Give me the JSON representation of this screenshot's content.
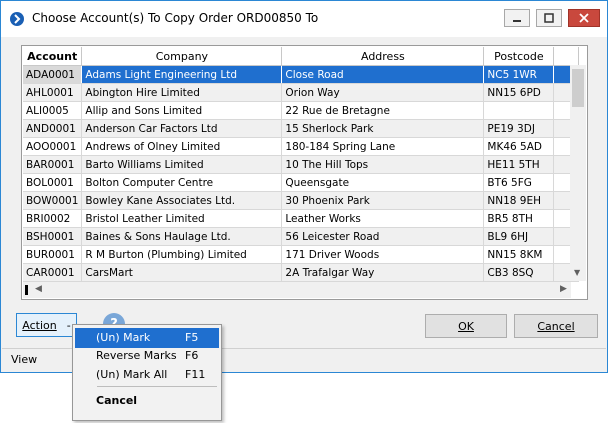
{
  "window": {
    "title": "Choose Account(s) To Copy Order ORD00850 To",
    "minimize_glyph": "—",
    "maximize_glyph": "□",
    "close_glyph": "✕"
  },
  "grid": {
    "columns": [
      "Account",
      "Company",
      "Address",
      "Postcode"
    ],
    "rows": [
      {
        "account": "ADA0001",
        "company": "Adams Light Engineering Ltd",
        "address": "Close Road",
        "postcode": "NC5 1WR"
      },
      {
        "account": "AHL0001",
        "company": "Abington Hire Limited",
        "address": "Orion Way",
        "postcode": "NN15 6PD"
      },
      {
        "account": "ALI0005",
        "company": "Allip and Sons Limited",
        "address": "22 Rue de Bretagne",
        "postcode": ""
      },
      {
        "account": "AND0001",
        "company": "Anderson Car Factors Ltd",
        "address": "15 Sherlock Park",
        "postcode": "PE19 3DJ"
      },
      {
        "account": "AOO0001",
        "company": "Andrews of Olney Limited",
        "address": "180-184 Spring Lane",
        "postcode": "MK46 5AD"
      },
      {
        "account": "BAR0001",
        "company": "Barto Williams Limited",
        "address": "10 The Hill Tops",
        "postcode": "HE11 5TH"
      },
      {
        "account": "BOL0001",
        "company": "Bolton Computer Centre",
        "address": "Queensgate",
        "postcode": "BT6 5FG"
      },
      {
        "account": "BOW0001",
        "company": "Bowley Kane Associates Ltd.",
        "address": "30 Phoenix Park",
        "postcode": "NN18 9EH"
      },
      {
        "account": "BRI0002",
        "company": "Bristol Leather Limited",
        "address": "Leather Works",
        "postcode": "BR5 8TH"
      },
      {
        "account": "BSH0001",
        "company": "Baines & Sons Haulage Ltd.",
        "address": "56 Leicester Road",
        "postcode": "BL9 6HJ"
      },
      {
        "account": "BUR0001",
        "company": "R M Burton (Plumbing) Limited",
        "address": "171 Driver Woods",
        "postcode": "NN15 8KM"
      },
      {
        "account": "CAR0001",
        "company": "CarsMart",
        "address": "2A Trafalgar Way",
        "postcode": "CB3 8SQ"
      }
    ]
  },
  "buttons": {
    "action_label": "Action",
    "action_caret": "-",
    "ok_label": "OK",
    "cancel_label": "Cancel",
    "help_glyph": "?"
  },
  "status": {
    "view_label": "View"
  },
  "menu": {
    "items": [
      {
        "label": "(Un) Mark",
        "key": "F5"
      },
      {
        "label": "Reverse Marks",
        "key": "F6"
      },
      {
        "label": "(Un) Mark All",
        "key": "F11"
      },
      {
        "label": "Cancel",
        "key": ""
      }
    ]
  },
  "colors": {
    "selection": "#1f6fcf",
    "accent": "#2b87d4",
    "close": "#c9483d"
  }
}
